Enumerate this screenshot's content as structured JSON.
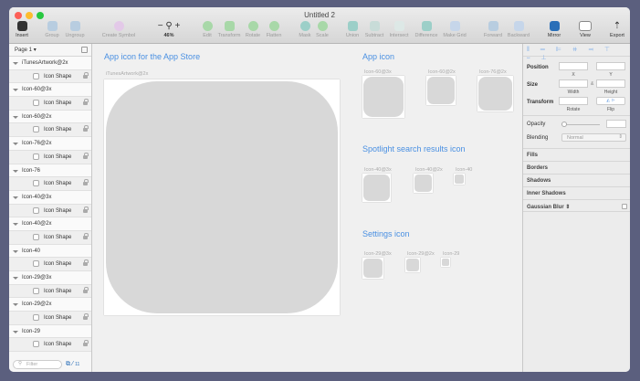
{
  "window": {
    "title": "Untitled 2"
  },
  "toolbar": {
    "insert": "Insert",
    "group": "Group",
    "ungroup": "Ungroup",
    "create_symbol": "Create Symbol",
    "zoom": "46%",
    "edit": "Edit",
    "transform": "Transform",
    "rotate": "Rotate",
    "flatten": "Flatten",
    "mask": "Mask",
    "scale": "Scale",
    "union": "Union",
    "subtract": "Subtract",
    "intersect": "Intersect",
    "difference": "Difference",
    "make_grid": "Make Grid",
    "forward": "Forward",
    "backward": "Backward",
    "mirror": "Mirror",
    "view": "View",
    "export": "Export"
  },
  "layers": {
    "page": "Page 1",
    "filter_placeholder": "Filter",
    "count": "11",
    "groups": [
      {
        "name": "iTunesArtwork@2x",
        "child": "Icon Shape"
      },
      {
        "name": "Icon-60@3x",
        "child": "Icon Shape"
      },
      {
        "name": "Icon-60@2x",
        "child": "Icon Shape"
      },
      {
        "name": "Icon-76@2x",
        "child": "Icon Shape"
      },
      {
        "name": "Icon-76",
        "child": "Icon Shape"
      },
      {
        "name": "Icon-40@3x",
        "child": "Icon Shape"
      },
      {
        "name": "Icon-40@2x",
        "child": "Icon Shape"
      },
      {
        "name": "Icon-40",
        "child": "Icon Shape"
      },
      {
        "name": "Icon-29@3x",
        "child": "Icon Shape"
      },
      {
        "name": "Icon-29@2x",
        "child": "Icon Shape"
      },
      {
        "name": "Icon-29",
        "child": "Icon Shape"
      }
    ]
  },
  "canvas": {
    "app_store_heading": "App icon for the App Store",
    "itunes_label": "iTunesArtwork@2x",
    "app_icon_heading": "App icon",
    "spotlight_heading": "Spotlight search results icon",
    "settings_heading": "Settings icon",
    "labels": [
      "Icon-60@3x",
      "Icon-60@2x",
      "Icon-76@2x",
      "Icon-40@3x",
      "Icon-40@2x",
      "Icon-40",
      "Icon-29@3x",
      "Icon-29@2x",
      "Icon-29"
    ]
  },
  "inspector": {
    "position": "Position",
    "x": "X",
    "y": "Y",
    "size": "Size",
    "width": "Width",
    "height": "Height",
    "transform": "Transform",
    "rotate": "Rotate",
    "flip": "Flip",
    "opacity": "Opacity",
    "blending": "Blending",
    "blending_value": "Normal",
    "fills": "Fills",
    "borders": "Borders",
    "shadows": "Shadows",
    "inner_shadows": "Inner Shadows",
    "gaussian_blur": "Gaussian Blur"
  }
}
